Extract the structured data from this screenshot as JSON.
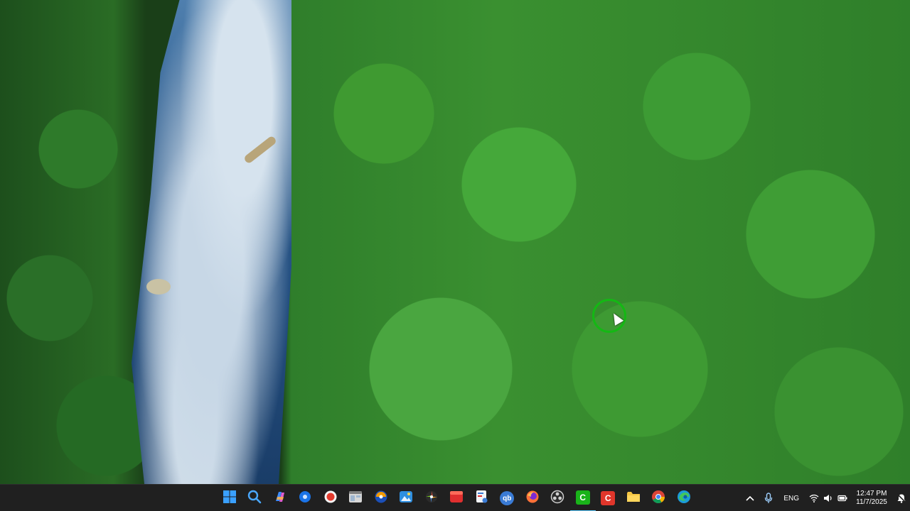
{
  "taskbar": {
    "pinned": [
      {
        "name": "start-button",
        "icon": "windows-logo-icon",
        "color": "#1e90ff"
      },
      {
        "name": "search-button",
        "icon": "search-icon",
        "color": "#1e90ff"
      },
      {
        "name": "copilot-button",
        "icon": "copilot-icon",
        "color": "#c85ee8"
      },
      {
        "name": "app-blue-circle-button",
        "icon": "blue-circle-app-icon",
        "color": "#1a73e8"
      },
      {
        "name": "app-record-button",
        "icon": "record-icon",
        "color": "#e33b2e"
      },
      {
        "name": "file-explorer-window-button",
        "icon": "window-icon",
        "color": "#8c8c8c"
      },
      {
        "name": "app-orange-blue-button",
        "icon": "orange-blue-app-icon",
        "color": "#f29900"
      },
      {
        "name": "photos-button",
        "icon": "photos-icon",
        "color": "#2f8fe0"
      },
      {
        "name": "app-colorwheel-button",
        "icon": "color-wheel-icon",
        "color": "#e0543c"
      },
      {
        "name": "app-red-window-button",
        "icon": "red-window-icon",
        "color": "#e02f2f"
      },
      {
        "name": "snipping-tool-button",
        "icon": "snipping-tool-icon",
        "color": "#d8dde6"
      },
      {
        "name": "qbittorrent-button",
        "icon": "qb-icon",
        "color": "#3a7bd5",
        "label": "qb"
      },
      {
        "name": "firefox-button",
        "icon": "firefox-icon",
        "color": "#ff7139"
      },
      {
        "name": "obs-button",
        "icon": "obs-icon",
        "color": "#cfcfcf"
      },
      {
        "name": "app-green-c-button",
        "icon": "green-c-app-icon",
        "color": "#19b319",
        "label": "C"
      },
      {
        "name": "app-red-c-button",
        "icon": "red-c-app-icon",
        "color": "#e0362b",
        "label": "C"
      },
      {
        "name": "file-explorer-button",
        "icon": "folder-icon",
        "color": "#f5c542"
      },
      {
        "name": "chrome-button",
        "icon": "chrome-icon",
        "color": "#34a853"
      },
      {
        "name": "edge-button",
        "icon": "edge-icon",
        "color": "#1c9bd8"
      }
    ],
    "tray": {
      "language": "ENG",
      "time": "12:47 PM",
      "date": "11/7/2025"
    }
  }
}
